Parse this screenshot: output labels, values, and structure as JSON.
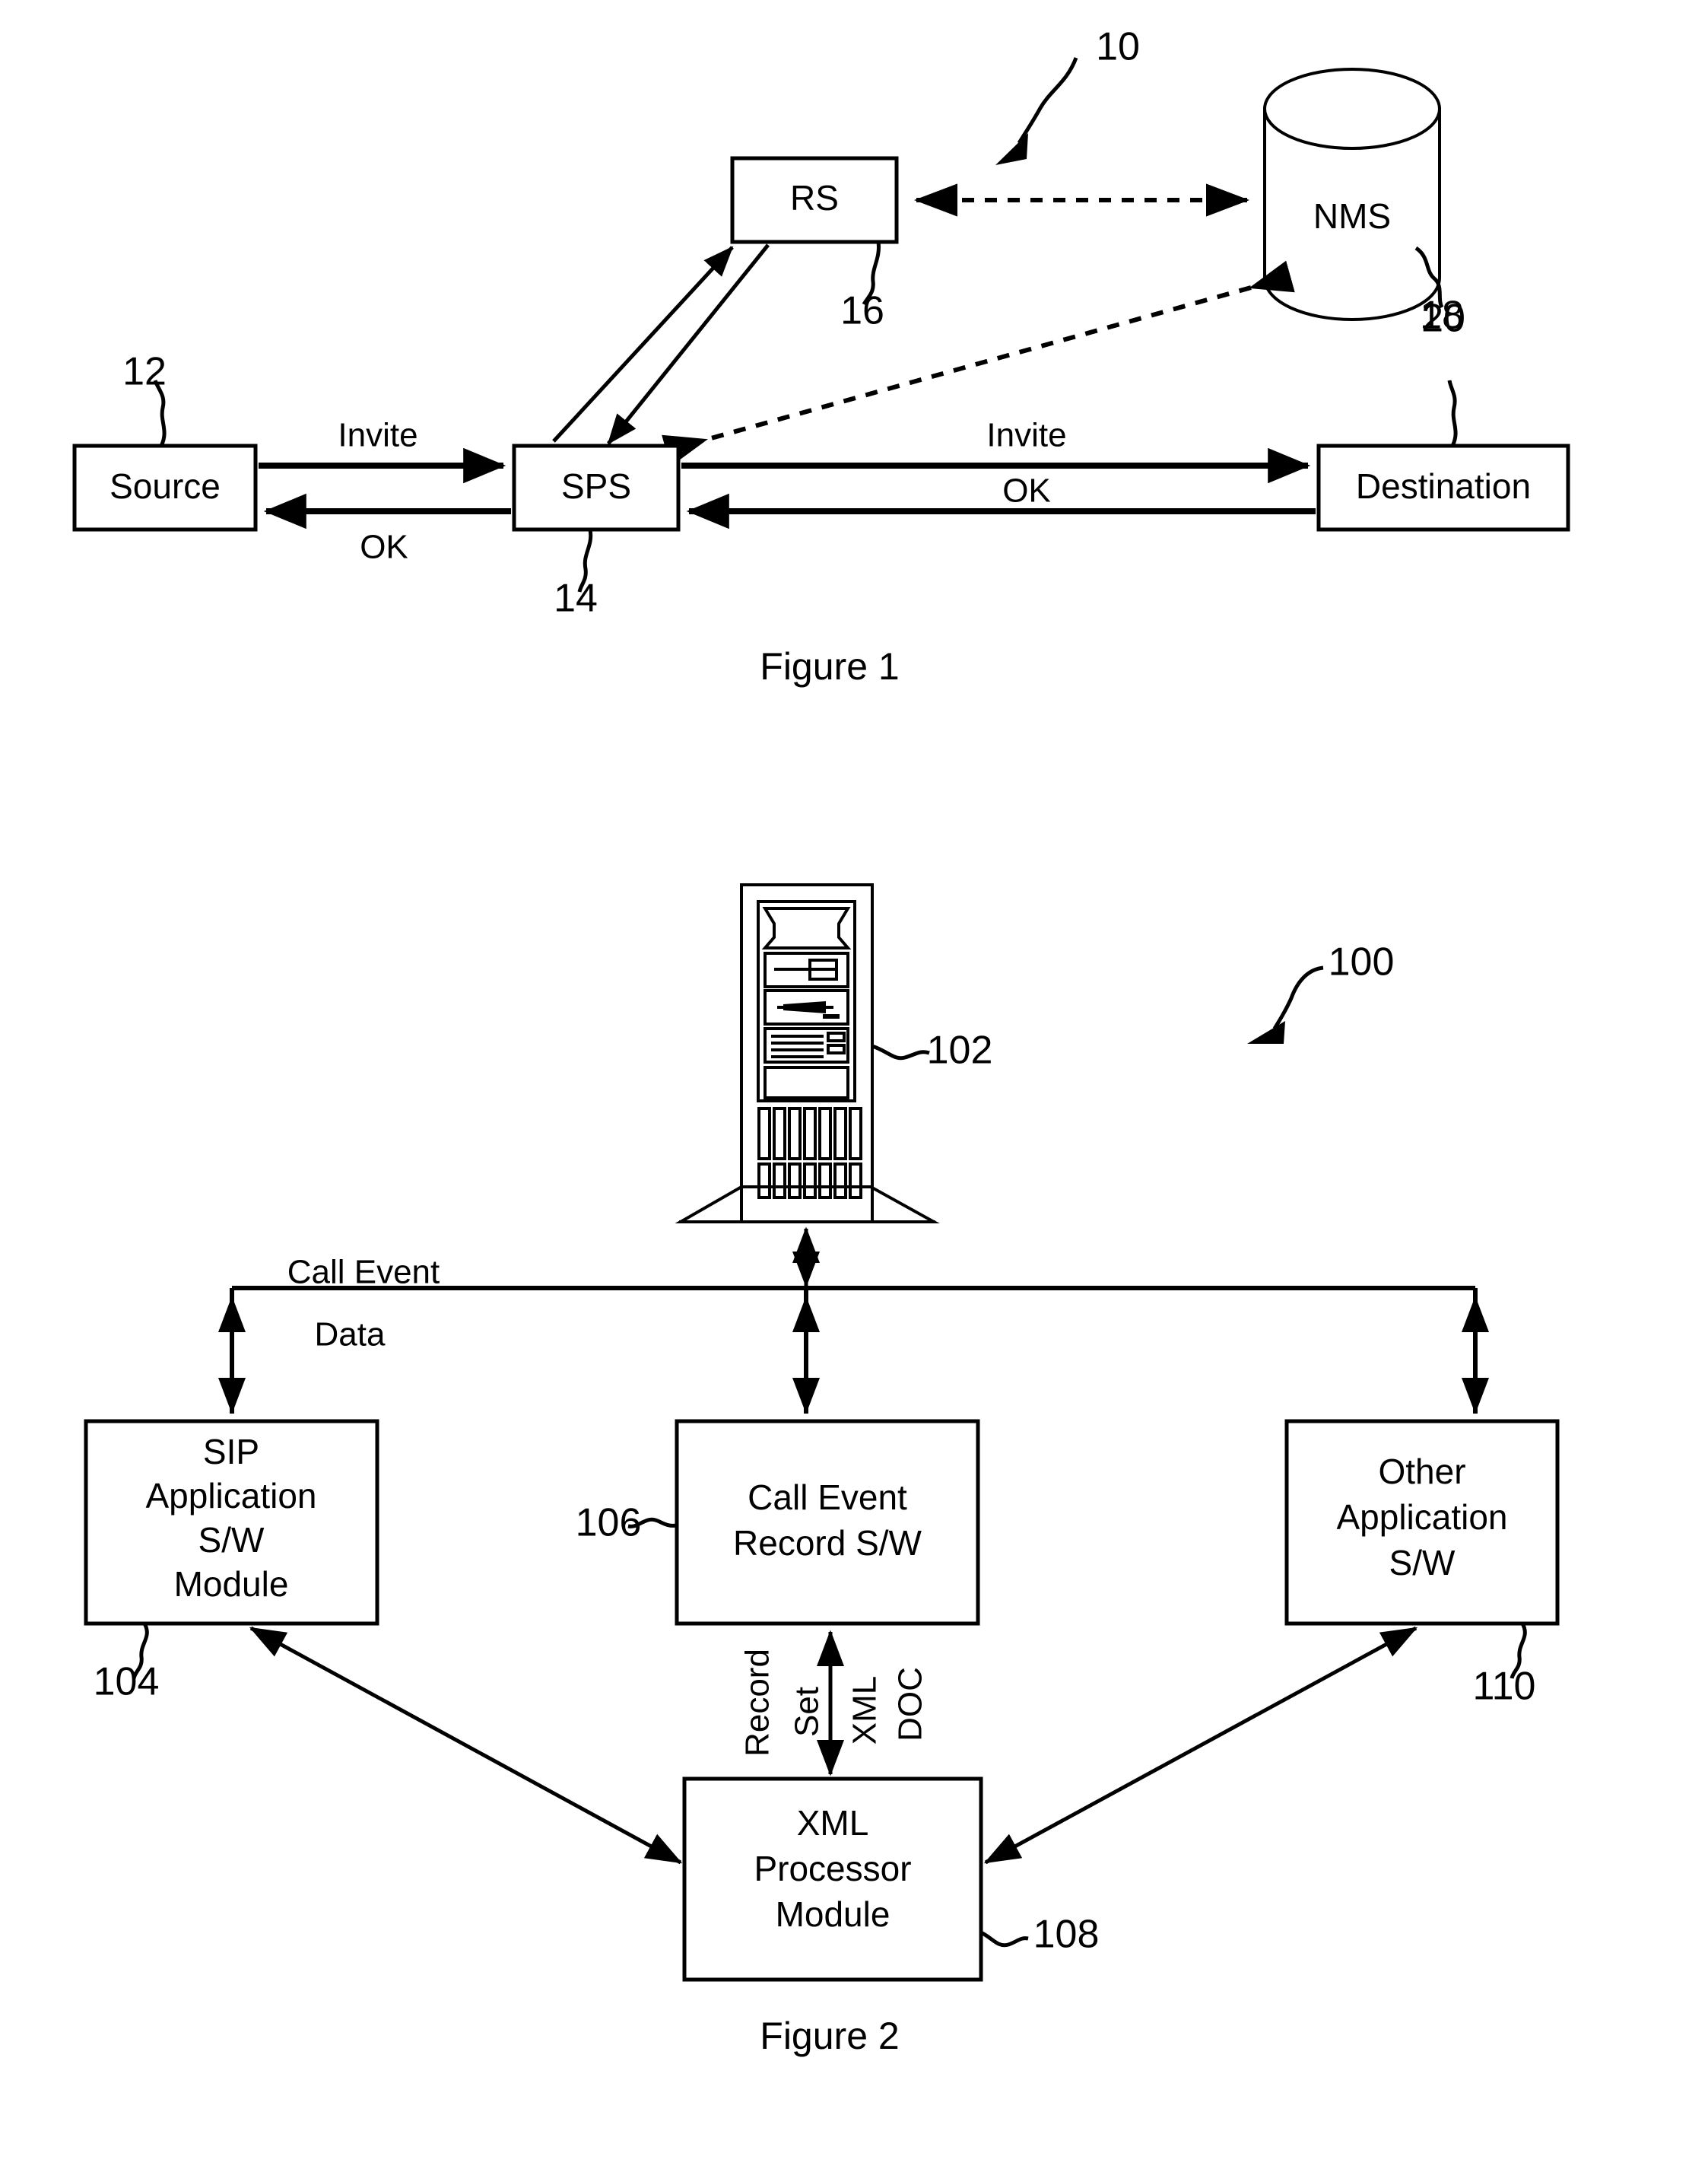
{
  "document": {
    "kind": "patent-drawing-sheet",
    "background_color": "#ffffff",
    "ink_color": "#000000"
  },
  "figure1": {
    "caption": "Figure 1",
    "assembly_ref": "10",
    "nodes": [
      {
        "id": "source",
        "label": "Source",
        "ref": "12",
        "shape": "rect"
      },
      {
        "id": "sps",
        "label": "SPS",
        "ref": "14",
        "shape": "rect"
      },
      {
        "id": "rs",
        "label": "RS",
        "ref": "16",
        "shape": "rect"
      },
      {
        "id": "destination",
        "label": "Destination",
        "ref": "18",
        "shape": "rect"
      },
      {
        "id": "nms",
        "label": "NMS",
        "ref": "20",
        "shape": "cylinder"
      }
    ],
    "edges": [
      {
        "from": "source",
        "to": "sps",
        "label": "Invite",
        "style": "solid",
        "arrow": "single"
      },
      {
        "from": "sps",
        "to": "source",
        "label": "OK",
        "style": "solid",
        "arrow": "single"
      },
      {
        "from": "sps",
        "to": "destination",
        "label": "Invite",
        "style": "solid",
        "arrow": "single"
      },
      {
        "from": "destination",
        "to": "sps",
        "label": "OK",
        "style": "solid",
        "arrow": "single"
      },
      {
        "from": "sps",
        "to": "rs",
        "label": "",
        "style": "solid",
        "arrow": "single"
      },
      {
        "from": "rs",
        "to": "sps",
        "label": "",
        "style": "solid",
        "arrow": "single"
      },
      {
        "from": "rs",
        "to": "nms",
        "label": "",
        "style": "dashed",
        "arrow": "double"
      },
      {
        "from": "nms",
        "to": "sps",
        "label": "",
        "style": "dashed",
        "arrow": "double"
      }
    ]
  },
  "figure2": {
    "caption": "Figure 2",
    "assembly_ref": "100",
    "server": {
      "id": "server",
      "ref": "102",
      "icon": "tower-computer-icon"
    },
    "bus": {
      "label_line1": "Call Event",
      "label_line2": "Data"
    },
    "modules": [
      {
        "id": "sip",
        "label": "SIP Application S/W Module",
        "lines": [
          "SIP",
          "Application",
          "S/W",
          "Module"
        ],
        "ref": "104"
      },
      {
        "id": "cer",
        "label": "Call Event Record S/W",
        "lines": [
          "Call Event",
          "Record S/W"
        ],
        "ref": "106"
      },
      {
        "id": "other",
        "label": "Other Application S/W",
        "lines": [
          "Other",
          "Application",
          "S/W"
        ],
        "ref": "110"
      },
      {
        "id": "xml",
        "label": "XML Processor Module",
        "lines": [
          "XML",
          "Processor",
          "Module"
        ],
        "ref": "108"
      }
    ],
    "vertical_labels": [
      {
        "id": "record",
        "text": "Record"
      },
      {
        "id": "set",
        "text": "Set"
      },
      {
        "id": "xmlv",
        "text": "XML"
      },
      {
        "id": "doc",
        "text": "DOC"
      }
    ]
  }
}
